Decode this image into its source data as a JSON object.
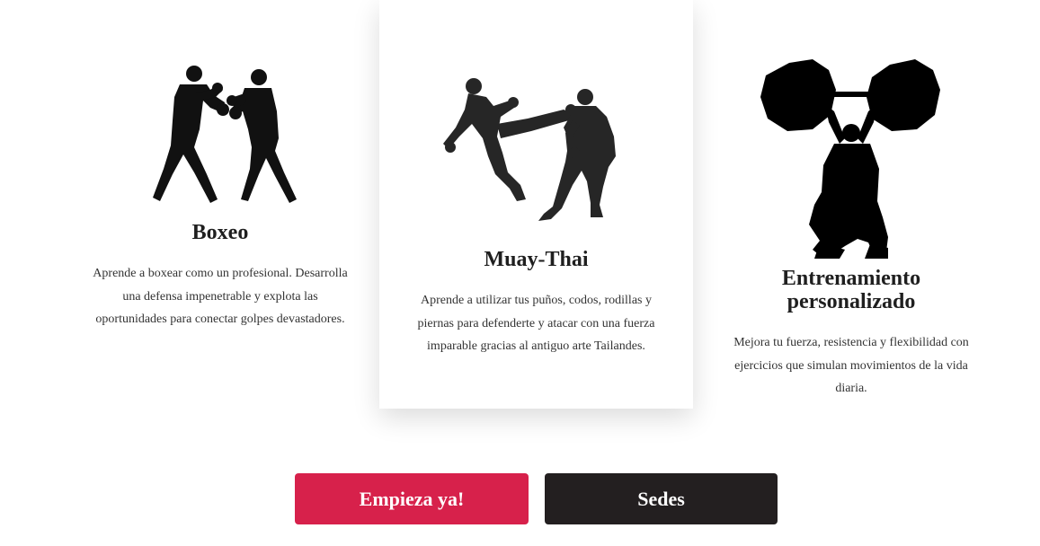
{
  "cards": [
    {
      "title": "Boxeo",
      "text": "Aprende a boxear como un profesional. Desarrolla una defensa impenetrable y explota las oportunidades para conectar golpes devastadores.",
      "icon": "boxing-silhouette-icon"
    },
    {
      "title": "Muay-Thai",
      "text": "Aprende a utilizar tus puños, codos, rodillas y piernas para defenderte y atacar con una fuerza imparable gracias al antiguo arte Tailandes.",
      "icon": "muay-thai-silhouette-icon"
    },
    {
      "title": "Entrenamiento personalizado",
      "text": "Mejora tu fuerza, resistencia y flexibilidad con ejercicios que simulan movimientos de la vida diaria.",
      "icon": "weightlifting-silhouette-icon"
    }
  ],
  "buttons": {
    "primary": "Empieza ya!",
    "secondary": "Sedes"
  },
  "colors": {
    "primary_button": "#d7214b",
    "secondary_button": "#231f20",
    "text": "#222222"
  }
}
